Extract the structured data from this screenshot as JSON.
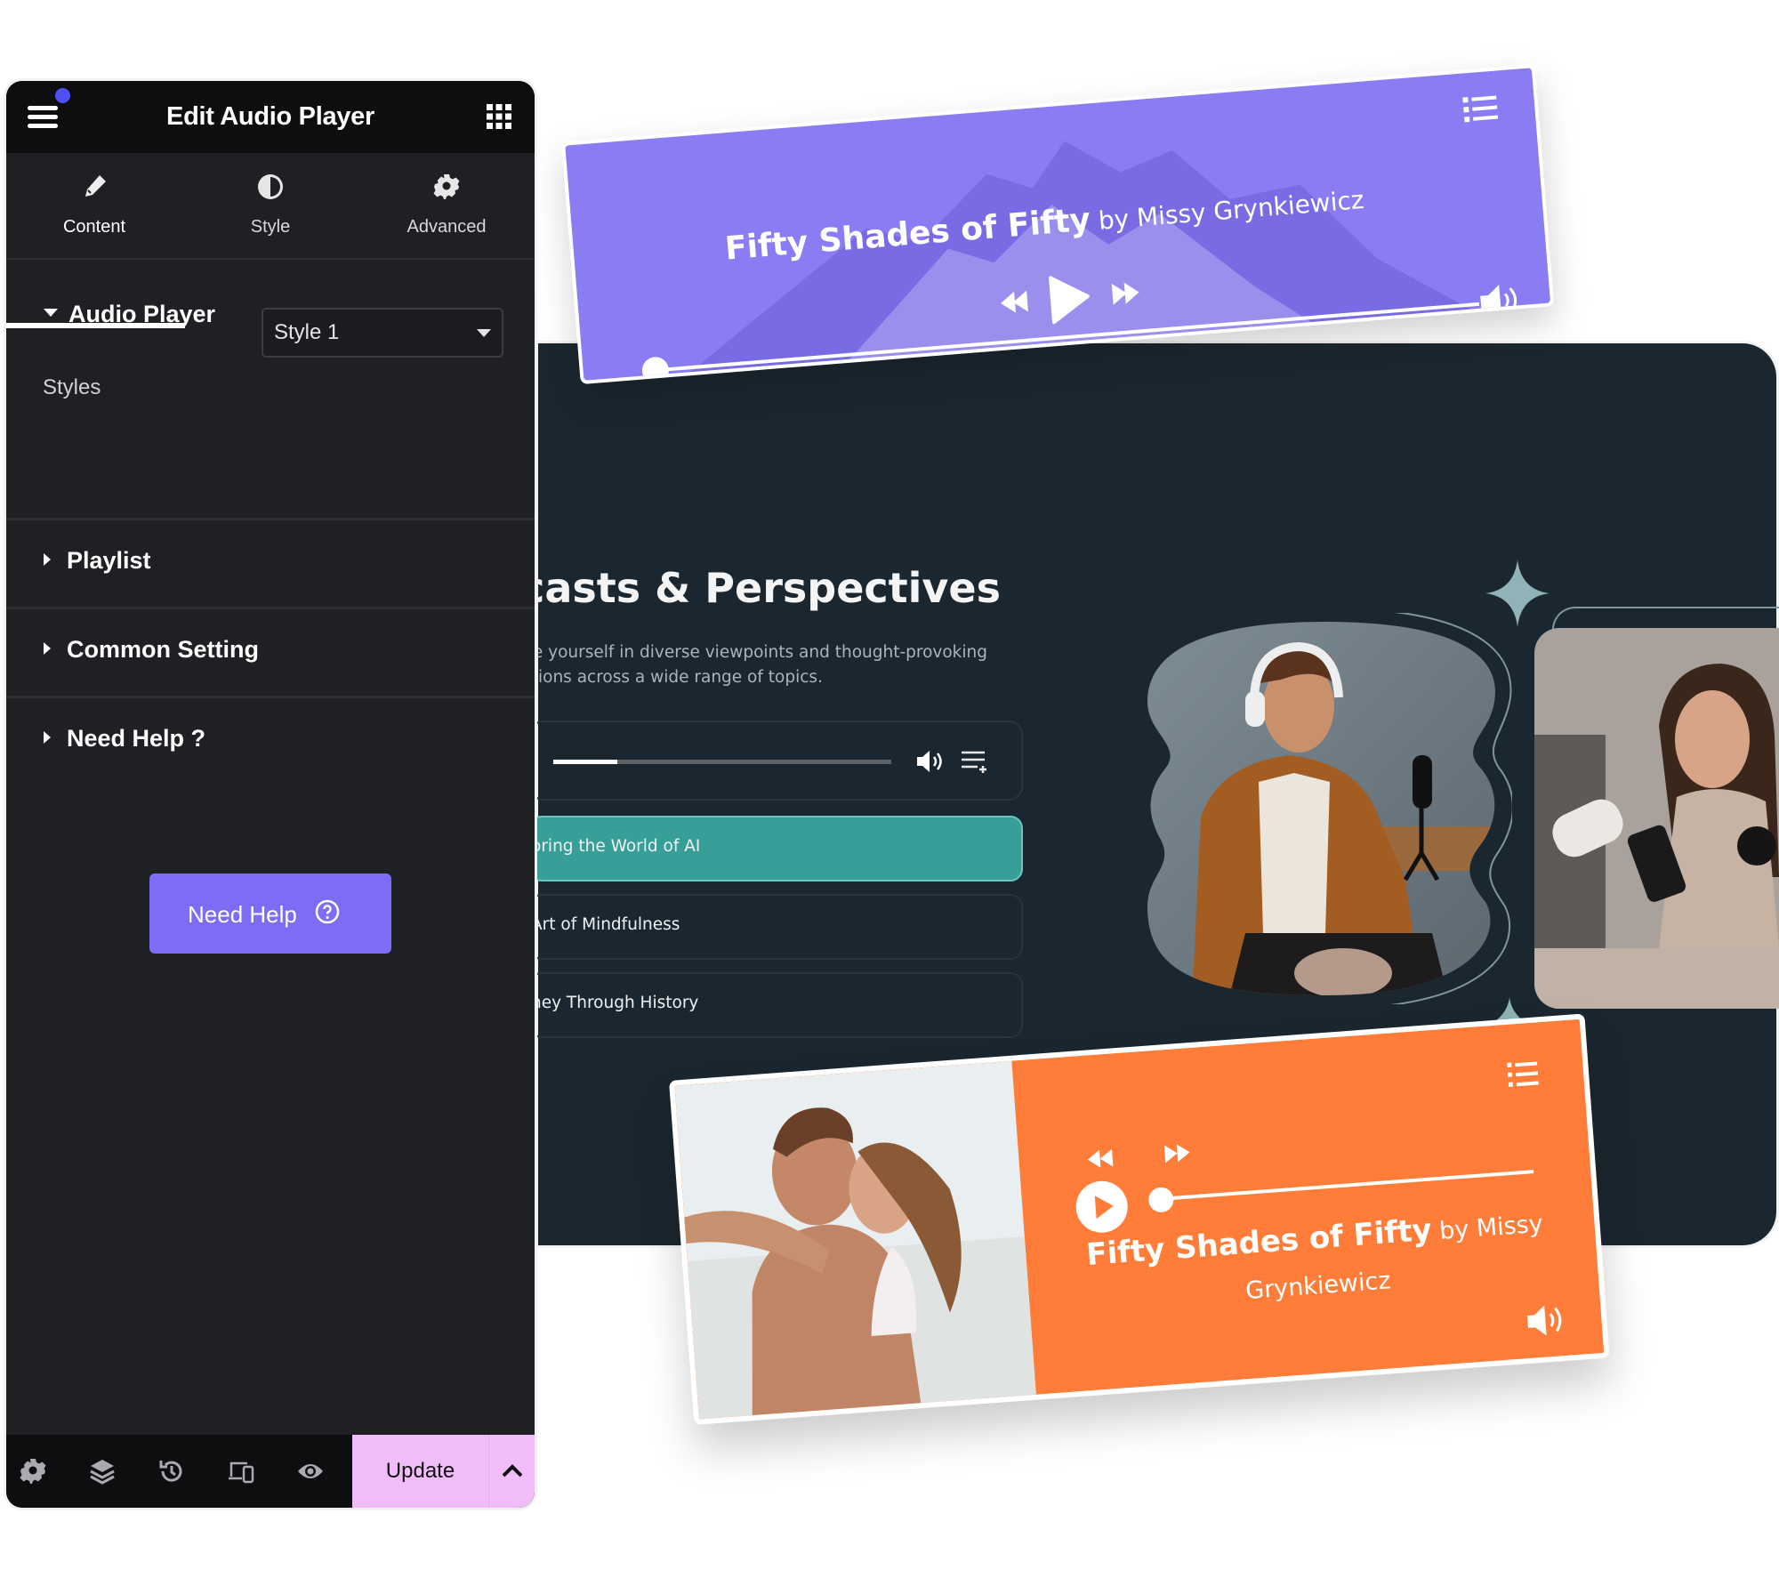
{
  "editor": {
    "title": "Edit Audio Player",
    "tabs": [
      {
        "label": "Content",
        "icon": "pencil-icon",
        "active": true
      },
      {
        "label": "Style",
        "icon": "contrast-icon",
        "active": false
      },
      {
        "label": "Advanced",
        "icon": "gear-icon",
        "active": false
      }
    ],
    "sections": {
      "audio_player": {
        "label": "Audio Player",
        "expanded": true,
        "fields": {
          "styles_label": "Styles",
          "styles_value": "Style 1"
        }
      },
      "playlist": {
        "label": "Playlist",
        "expanded": false
      },
      "common_setting": {
        "label": "Common Setting",
        "expanded": false
      },
      "need_help": {
        "label": "Need Help ?",
        "expanded": false
      }
    },
    "help_button": {
      "label": "Need Help",
      "icon": "question-circle-icon"
    },
    "footer": {
      "icons": [
        "gear-icon",
        "layers-icon",
        "history-icon",
        "responsive-icon",
        "eye-icon"
      ],
      "update_label": "Update",
      "more_icon": "chevron-up-icon"
    },
    "colors": {
      "accent_button": "#7d6cf5",
      "notification_dot": "#4f4ff6",
      "update_button": "#f1bdf8"
    }
  },
  "preview": {
    "heading": "dcasts & Perspectives",
    "description_lines": [
      "e yourself in diverse viewpoints and thought-provoking",
      "ions across a wide range of topics."
    ],
    "mini_player": {
      "progress_fraction": 0.19,
      "icons": [
        "volume-icon",
        "queue-add-icon"
      ]
    },
    "tracks": [
      {
        "title": "oring the World of AI",
        "active": true
      },
      {
        "title": "Art of Mindfulness",
        "active": false
      },
      {
        "title": "ney Through History",
        "active": false
      }
    ],
    "colors": {
      "background": "#1b2730",
      "active_track": "#379f98",
      "sparkle": "#8fb3b6"
    }
  },
  "purple_player": {
    "title": "Fifty Shades of Fifty",
    "byline": " by Missy Grynkiewicz",
    "progress_fraction": 0.0,
    "color": "#8a7cf2",
    "icons": [
      "playlist-icon",
      "rewind-icon",
      "play-icon",
      "fast-forward-icon",
      "volume-icon"
    ]
  },
  "orange_player": {
    "title": "Fifty Shades of Fifty",
    "byline_1": " by Missy",
    "byline_2": "Grynkiewicz",
    "progress_fraction": 0.0,
    "color": "#ff7d38",
    "icons": [
      "playlist-icon",
      "rewind-icon",
      "fast-forward-icon",
      "play-circle-icon",
      "volume-icon"
    ]
  }
}
